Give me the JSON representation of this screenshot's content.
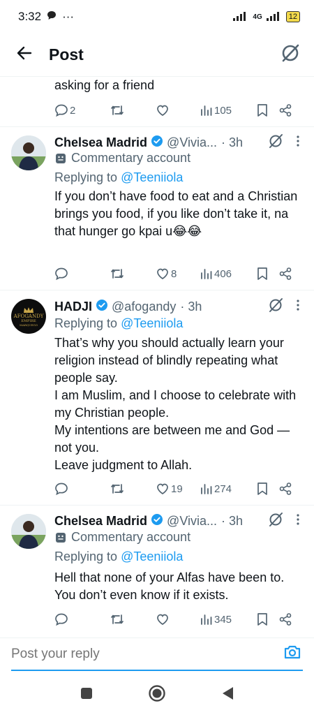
{
  "status": {
    "time": "3:32",
    "network": "4G",
    "battery": "12"
  },
  "header": {
    "title": "Post"
  },
  "top_fragment": {
    "text": "asking for a friend",
    "replies": "2",
    "likes": "",
    "views": "105"
  },
  "tweets": [
    {
      "name": "Chelsea Madrid",
      "handle": "@Vivia...",
      "time": "· 3h",
      "commentary": "Commentary account",
      "replying_prefix": "Replying to ",
      "replying_to": "@Teeniiola",
      "body": [
        "If you don’t have food to eat and a Christian brings you food, if you like don’t take it, na that hunger go kpai u😂😂"
      ],
      "replies": "",
      "likes": "8",
      "views": "406"
    },
    {
      "name": "HADJI",
      "handle": "@afogandy",
      "time": "· 3h",
      "replying_prefix": "Replying to ",
      "replying_to": "@Teeniiola",
      "body": [
        "That’s why you should actually learn your religion instead of blindly repeating what people say.",
        "I am Muslim, and I choose to celebrate with my Christian people.",
        "My intentions are between me and God — not you.",
        "Leave judgment to Allah."
      ],
      "avatar_text": [
        "AFOGANDY",
        "EMPIRE",
        "MARQUEGO"
      ],
      "replies": "",
      "likes": "19",
      "views": "274"
    },
    {
      "name": "Chelsea Madrid",
      "handle": "@Vivia...",
      "time": "· 3h",
      "commentary": "Commentary account",
      "replying_prefix": "Replying to ",
      "replying_to": "@Teeniiola",
      "body": [
        "Hell that none of your Alfas have been to. You don’t even know if it exists."
      ],
      "replies": "",
      "likes": "",
      "views": "345"
    }
  ],
  "compose": {
    "placeholder": "Post your reply"
  },
  "colors": {
    "accent": "#1d9bf0",
    "muted": "#536471",
    "text": "#0f1419"
  }
}
